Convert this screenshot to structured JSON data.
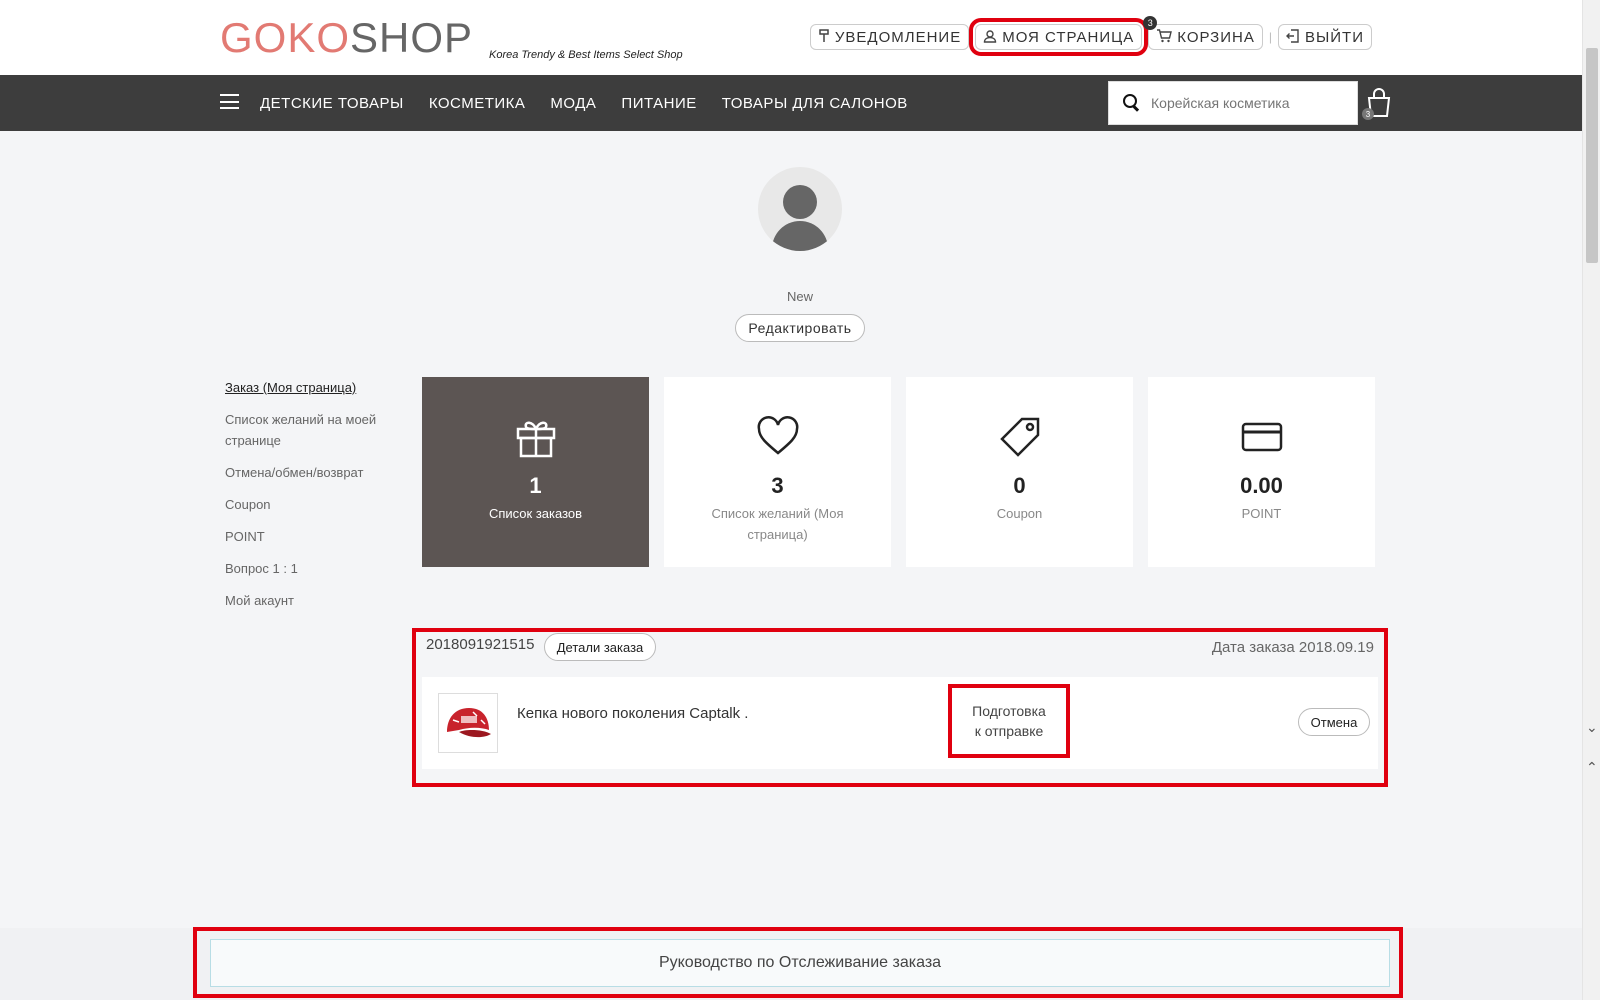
{
  "brand": {
    "logo_part1": "GOKO",
    "logo_part2": "SHOP",
    "tagline": "Korea Trendy & Best Items Select Shop"
  },
  "top_links": {
    "notification": "УВЕДОМЛЕНИЕ",
    "my_page": "МОЯ СТРАНИЦА",
    "cart": "КОРЗИНА",
    "cart_count": "3",
    "logout": "ВЫЙТИ"
  },
  "nav": {
    "items": [
      "ДЕТСКИЕ ТОВАРЫ",
      "КОСМЕТИКА",
      "МОДА",
      "ПИТАНИЕ",
      "ТОВАРЫ ДЛЯ САЛОНОВ"
    ],
    "search_placeholder": "Корейская косметика",
    "bag_count": "3"
  },
  "profile": {
    "grade": "New",
    "edit_label": "Редактировать"
  },
  "sidebar": {
    "items": [
      "Заказ (Моя страница)",
      "Список желаний на моей странице",
      "Отмена/обмен/возврат",
      "Coupon",
      "POINT",
      "Вопрос 1 : 1",
      "Мой акаунт"
    ]
  },
  "cards": [
    {
      "icon": "gift-icon",
      "value": "1",
      "label": "Список заказов"
    },
    {
      "icon": "heart-icon",
      "value": "3",
      "label": "Список желаний (Моя страница)"
    },
    {
      "icon": "tag-icon",
      "value": "0",
      "label": "Coupon"
    },
    {
      "icon": "card-icon",
      "value": "0.00",
      "label": "POINT"
    }
  ],
  "order": {
    "number": "2018091921515",
    "details_label": "Детали заказа",
    "date": "Дата заказа 2018.09.19",
    "product_name": "Кепка нового поколения Captalk .",
    "status_line1": "Подготовка",
    "status_line2": "к отправке",
    "cancel_label": "Отмена"
  },
  "guide": {
    "label": "Руководство по Отслеживание заказа"
  },
  "colors": {
    "accent_red": "#e0000f",
    "nav_bg": "#3d3d3d",
    "logo_pink": "#e27a73",
    "dark_card": "#5c5553"
  }
}
